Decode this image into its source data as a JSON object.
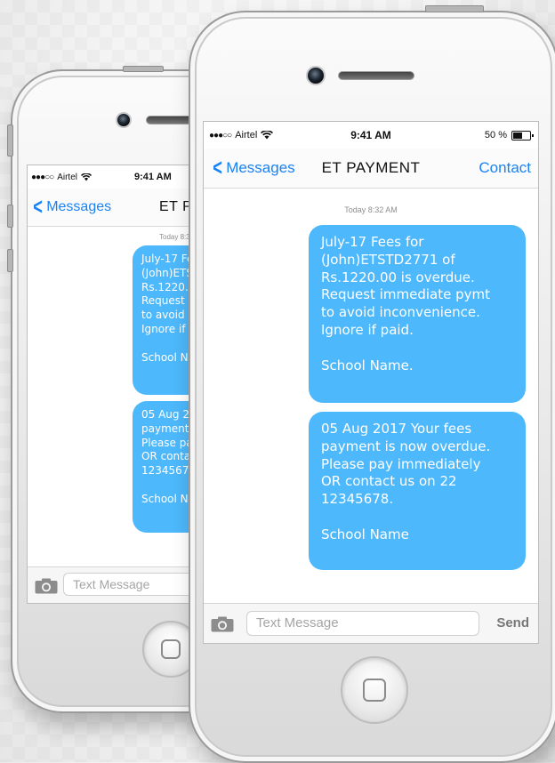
{
  "status_bar": {
    "signal_dots": "●●●○○",
    "carrier": "Airtel",
    "wifi_icon": "wifi-icon",
    "time": "9:41 AM",
    "battery_text": "50 %"
  },
  "nav": {
    "back_label": "Messages",
    "title": "ET PAYMENT",
    "contact_label": "Contact"
  },
  "back_phone_nav": {
    "title": "ET PAY"
  },
  "thread": {
    "timestamp": "Today 8:32 AM",
    "messages": [
      {
        "text": "July-17 Fees for\n(John)ETSTD2771 of\nRs.1220.00 is overdue.\nRequest immediate pymt\nto avoid inconvenience.\nIgnore if paid.\n\nSchool Name."
      },
      {
        "text": "05 Aug 2017 Your fees\npayment is now overdue.\nPlease pay immediately\nOR contact us on 22\n12345678.\n\nSchool Name"
      }
    ]
  },
  "back_phone_thread": {
    "timestamp": "Today 8:32",
    "messages": [
      {
        "text": "July-17 Fe\n(John)ETST\nRs.1220.0\nRequest i\nto avoid i\nIgnore if p\n\nSchool Na"
      },
      {
        "text": "05 Aug 20\npayment i\nPlease pa\nOR contac\n12345678\n\nSchool Na"
      }
    ]
  },
  "compose": {
    "placeholder": "Text Message",
    "send_label": "Send"
  },
  "colors": {
    "bubble": "#4db8fb",
    "ios_blue": "#1a82f5"
  }
}
